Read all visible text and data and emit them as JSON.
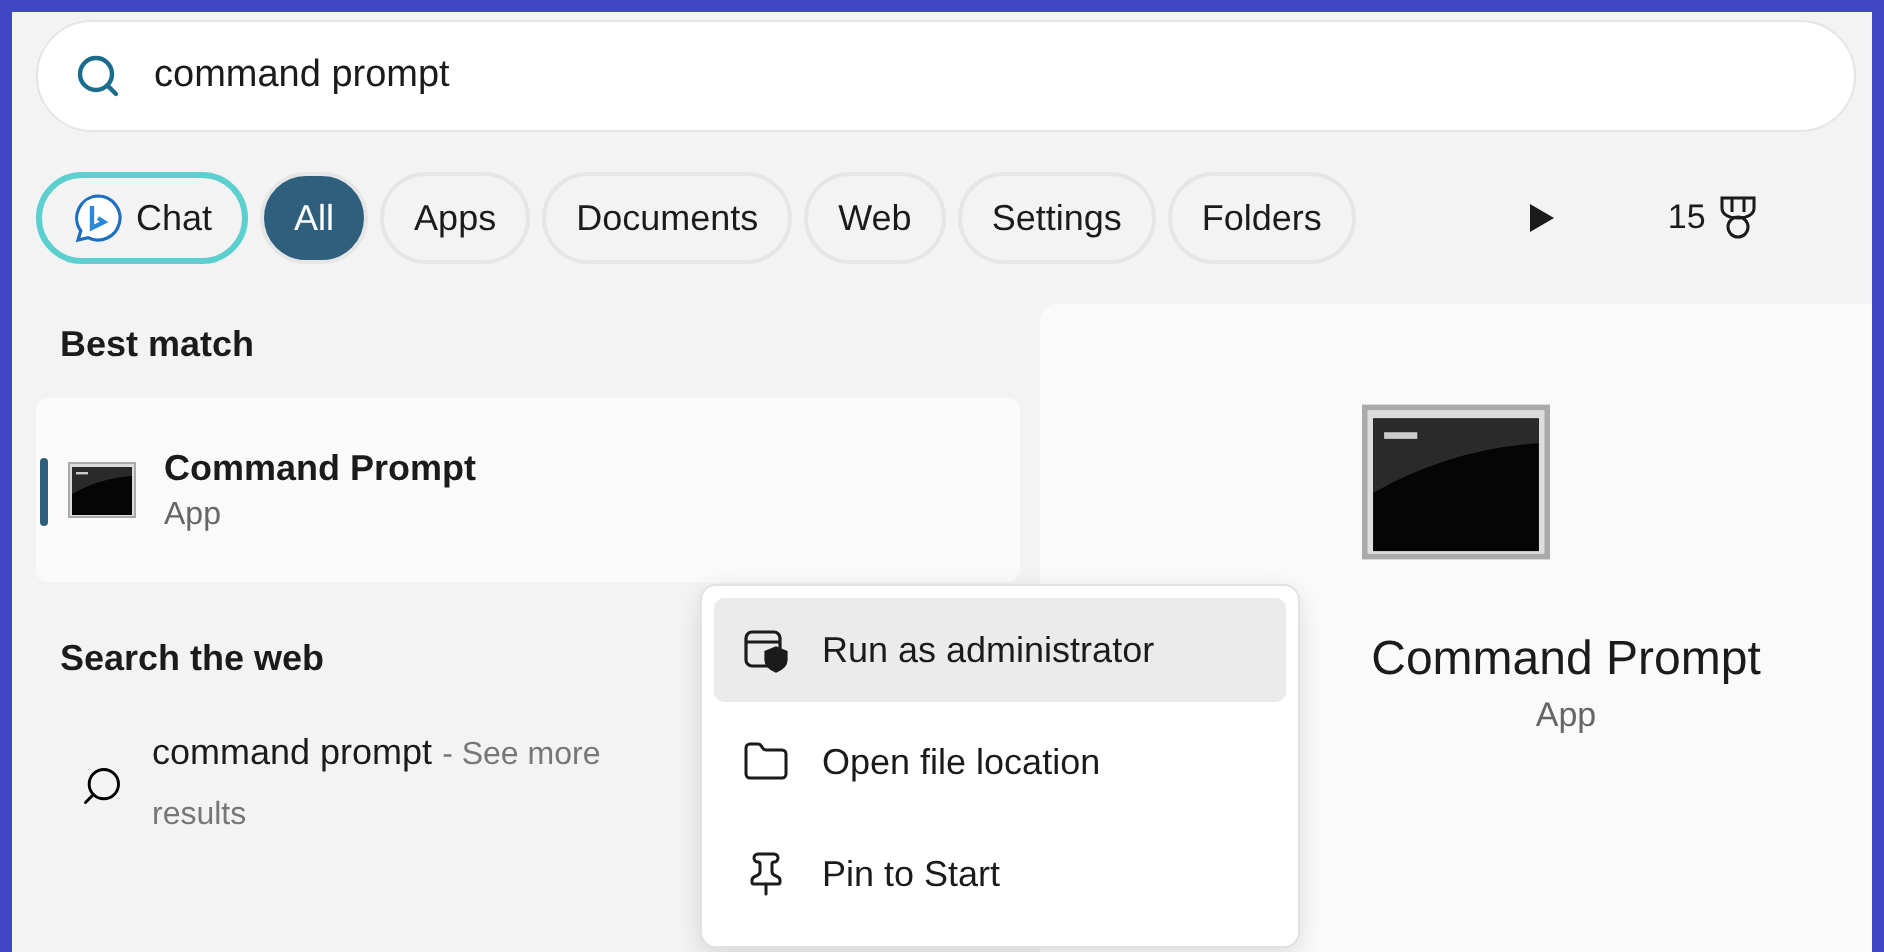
{
  "search": {
    "value": "command prompt"
  },
  "filters": [
    {
      "label": "Chat",
      "kind": "chat",
      "selected": false
    },
    {
      "label": "All",
      "kind": "chip",
      "selected": true
    },
    {
      "label": "Apps",
      "kind": "chip",
      "selected": false
    },
    {
      "label": "Documents",
      "kind": "chip",
      "selected": false
    },
    {
      "label": "Web",
      "kind": "chip",
      "selected": false
    },
    {
      "label": "Settings",
      "kind": "chip",
      "selected": false
    },
    {
      "label": "Folders",
      "kind": "chip",
      "selected": false
    }
  ],
  "points": "15",
  "best_match": {
    "heading": "Best match",
    "title": "Command Prompt",
    "subtitle": "App",
    "selected": true
  },
  "web": {
    "heading": "Search the web",
    "query": "command prompt",
    "hint": "- See more results"
  },
  "context_menu": [
    {
      "label": "Run as administrator",
      "selected": true
    },
    {
      "label": "Open file location",
      "selected": false
    },
    {
      "label": "Pin to Start",
      "selected": false
    }
  ],
  "preview": {
    "title": "Command Prompt",
    "subtitle": "App"
  }
}
